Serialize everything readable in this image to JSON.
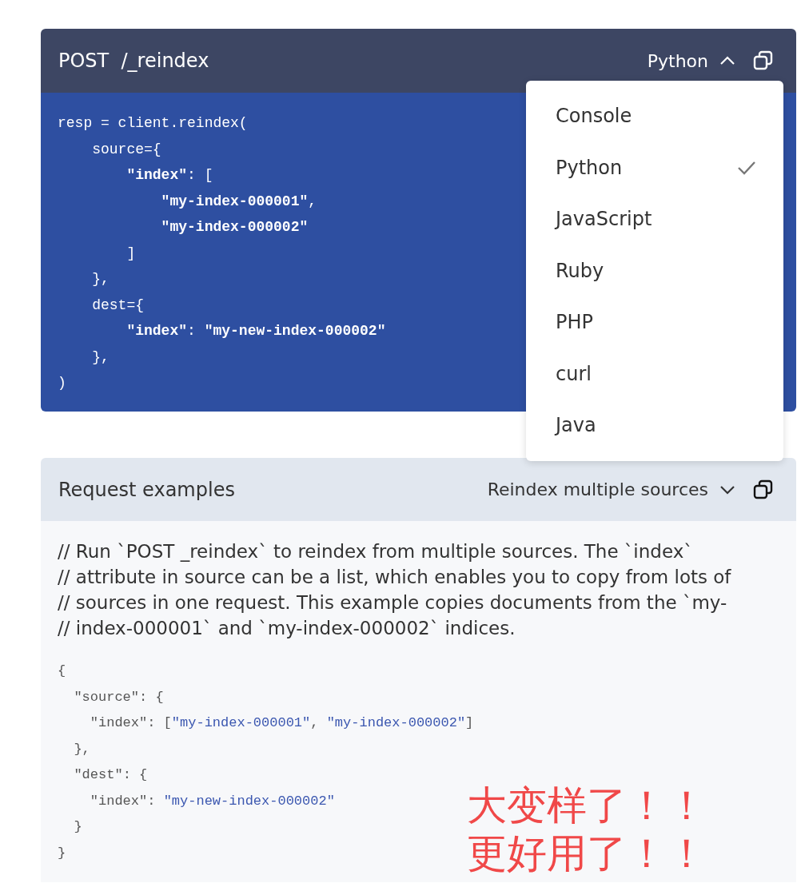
{
  "console": {
    "method": "POST",
    "path": "/_reindex",
    "language": "Python",
    "menu_expanded": true,
    "code": [
      [
        {
          "text": "resp = client.reindex(",
          "kind": "plain"
        }
      ],
      [
        {
          "text": "    source={",
          "kind": "plain"
        }
      ],
      [
        {
          "text": "        \"index\"",
          "kind": "string"
        },
        {
          "text": ": [",
          "kind": "plain"
        }
      ],
      [
        {
          "text": "            \"my-index-000001\"",
          "kind": "string"
        },
        {
          "text": ",",
          "kind": "plain"
        }
      ],
      [
        {
          "text": "            \"my-index-000002\"",
          "kind": "string"
        }
      ],
      [
        {
          "text": "        ]",
          "kind": "plain"
        }
      ],
      [
        {
          "text": "    },",
          "kind": "plain"
        }
      ],
      [
        {
          "text": "    dest={",
          "kind": "plain"
        }
      ],
      [
        {
          "text": "        \"index\"",
          "kind": "string"
        },
        {
          "text": ": ",
          "kind": "plain"
        },
        {
          "text": "\"my-new-index-000002\"",
          "kind": "string"
        }
      ],
      [
        {
          "text": "    },",
          "kind": "plain"
        }
      ],
      [
        {
          "text": ")",
          "kind": "plain"
        }
      ]
    ],
    "menu": [
      {
        "label": "Console",
        "selected": false
      },
      {
        "label": "Python",
        "selected": true
      },
      {
        "label": "JavaScript",
        "selected": false
      },
      {
        "label": "Ruby",
        "selected": false
      },
      {
        "label": "PHP",
        "selected": false
      },
      {
        "label": "curl",
        "selected": false
      },
      {
        "label": "Java",
        "selected": false
      }
    ]
  },
  "request_examples": {
    "title": "Request examples",
    "example": "Reindex multiple sources",
    "example_menu_expanded": false,
    "comment": [
      "// Run `POST _reindex` to reindex from multiple sources. The `index`",
      "// attribute in source can be a list, which enables you to copy from lots of",
      "// sources in one request. This example copies documents from the `my-",
      "// index-000001` and `my-index-000002` indices."
    ],
    "code": [
      [
        {
          "text": "{",
          "kind": "plain"
        }
      ],
      [
        {
          "text": "  \"source\"",
          "kind": "key"
        },
        {
          "text": ": {",
          "kind": "plain"
        }
      ],
      [
        {
          "text": "    \"index\"",
          "kind": "key"
        },
        {
          "text": ": [",
          "kind": "plain"
        },
        {
          "text": "\"my-index-000001\"",
          "kind": "string"
        },
        {
          "text": ", ",
          "kind": "plain"
        },
        {
          "text": "\"my-index-000002\"",
          "kind": "string"
        },
        {
          "text": "]",
          "kind": "plain"
        }
      ],
      [
        {
          "text": "  },",
          "kind": "plain"
        }
      ],
      [
        {
          "text": "  \"dest\"",
          "kind": "key"
        },
        {
          "text": ": {",
          "kind": "plain"
        }
      ],
      [
        {
          "text": "    \"index\"",
          "kind": "key"
        },
        {
          "text": ": ",
          "kind": "plain"
        },
        {
          "text": "\"my-new-index-000002\"",
          "kind": "string"
        }
      ],
      [
        {
          "text": "  }",
          "kind": "plain"
        }
      ],
      [
        {
          "text": "}",
          "kind": "plain"
        }
      ]
    ]
  },
  "annotation": [
    "大变样了！！",
    "更好用了！！"
  ]
}
